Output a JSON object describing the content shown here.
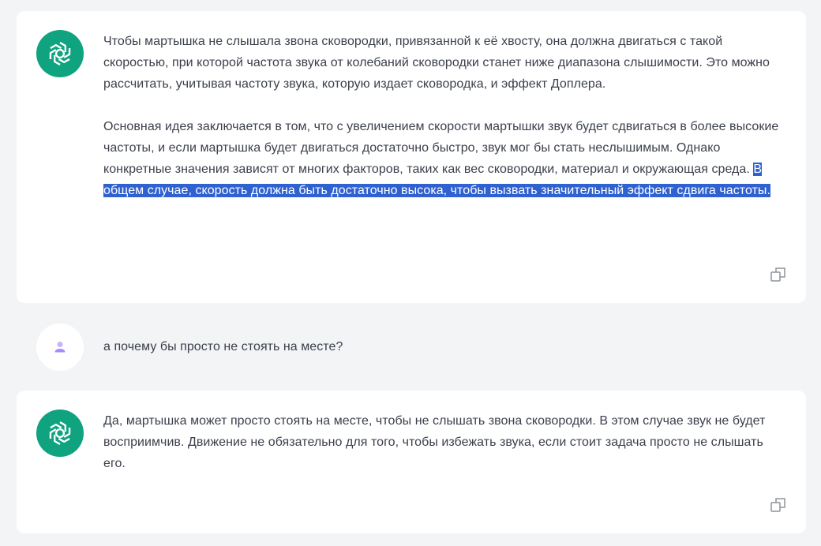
{
  "conversation": {
    "assistant_1": {
      "paragraph_1": "Чтобы мартышка не слышала звона сковородки, привязанной к её хвосту, она должна двигаться с такой скоростью, при которой частота звука от колебаний сковородки станет ниже диапазона слышимости. Это можно рассчитать, учитывая частоту звука, которую издает сковородка, и эффект Доплера.",
      "paragraph_2": "Основная идея заключается в том, что с увеличением скорости мартышки звук будет сдвигаться в более высокие частоты, и если мартышка будет двигаться достаточно быстро, звук мог бы стать неслышимым. Однако конкретные значения зависят от многих факторов, таких как вес сковородки, материал и окружающая среда.",
      "paragraph_2_highlight": "В общем случае, скорость должна быть достаточно высока, чтобы вызвать значительный эффект сдвига частоты."
    },
    "user_1": {
      "text": "а почему бы просто не стоять на месте?"
    },
    "assistant_2": {
      "paragraph_1": "Да, мартышка может просто стоять на месте, чтобы не слышать звона сковородки. В этом случае звук не будет восприимчив. Движение не обязательно для того, чтобы избежать звука, если стоит задача просто не слышать его."
    }
  },
  "icons": {
    "assistant_avatar": "openai-logo-icon",
    "user_avatar": "user-icon",
    "copy": "copy-icon"
  },
  "colors": {
    "assistant_avatar_bg": "#10a37f",
    "selection_highlight": "#2f62d0",
    "page_bg": "#f3f4f6",
    "user_avatar_accent": "#a78bfa"
  }
}
